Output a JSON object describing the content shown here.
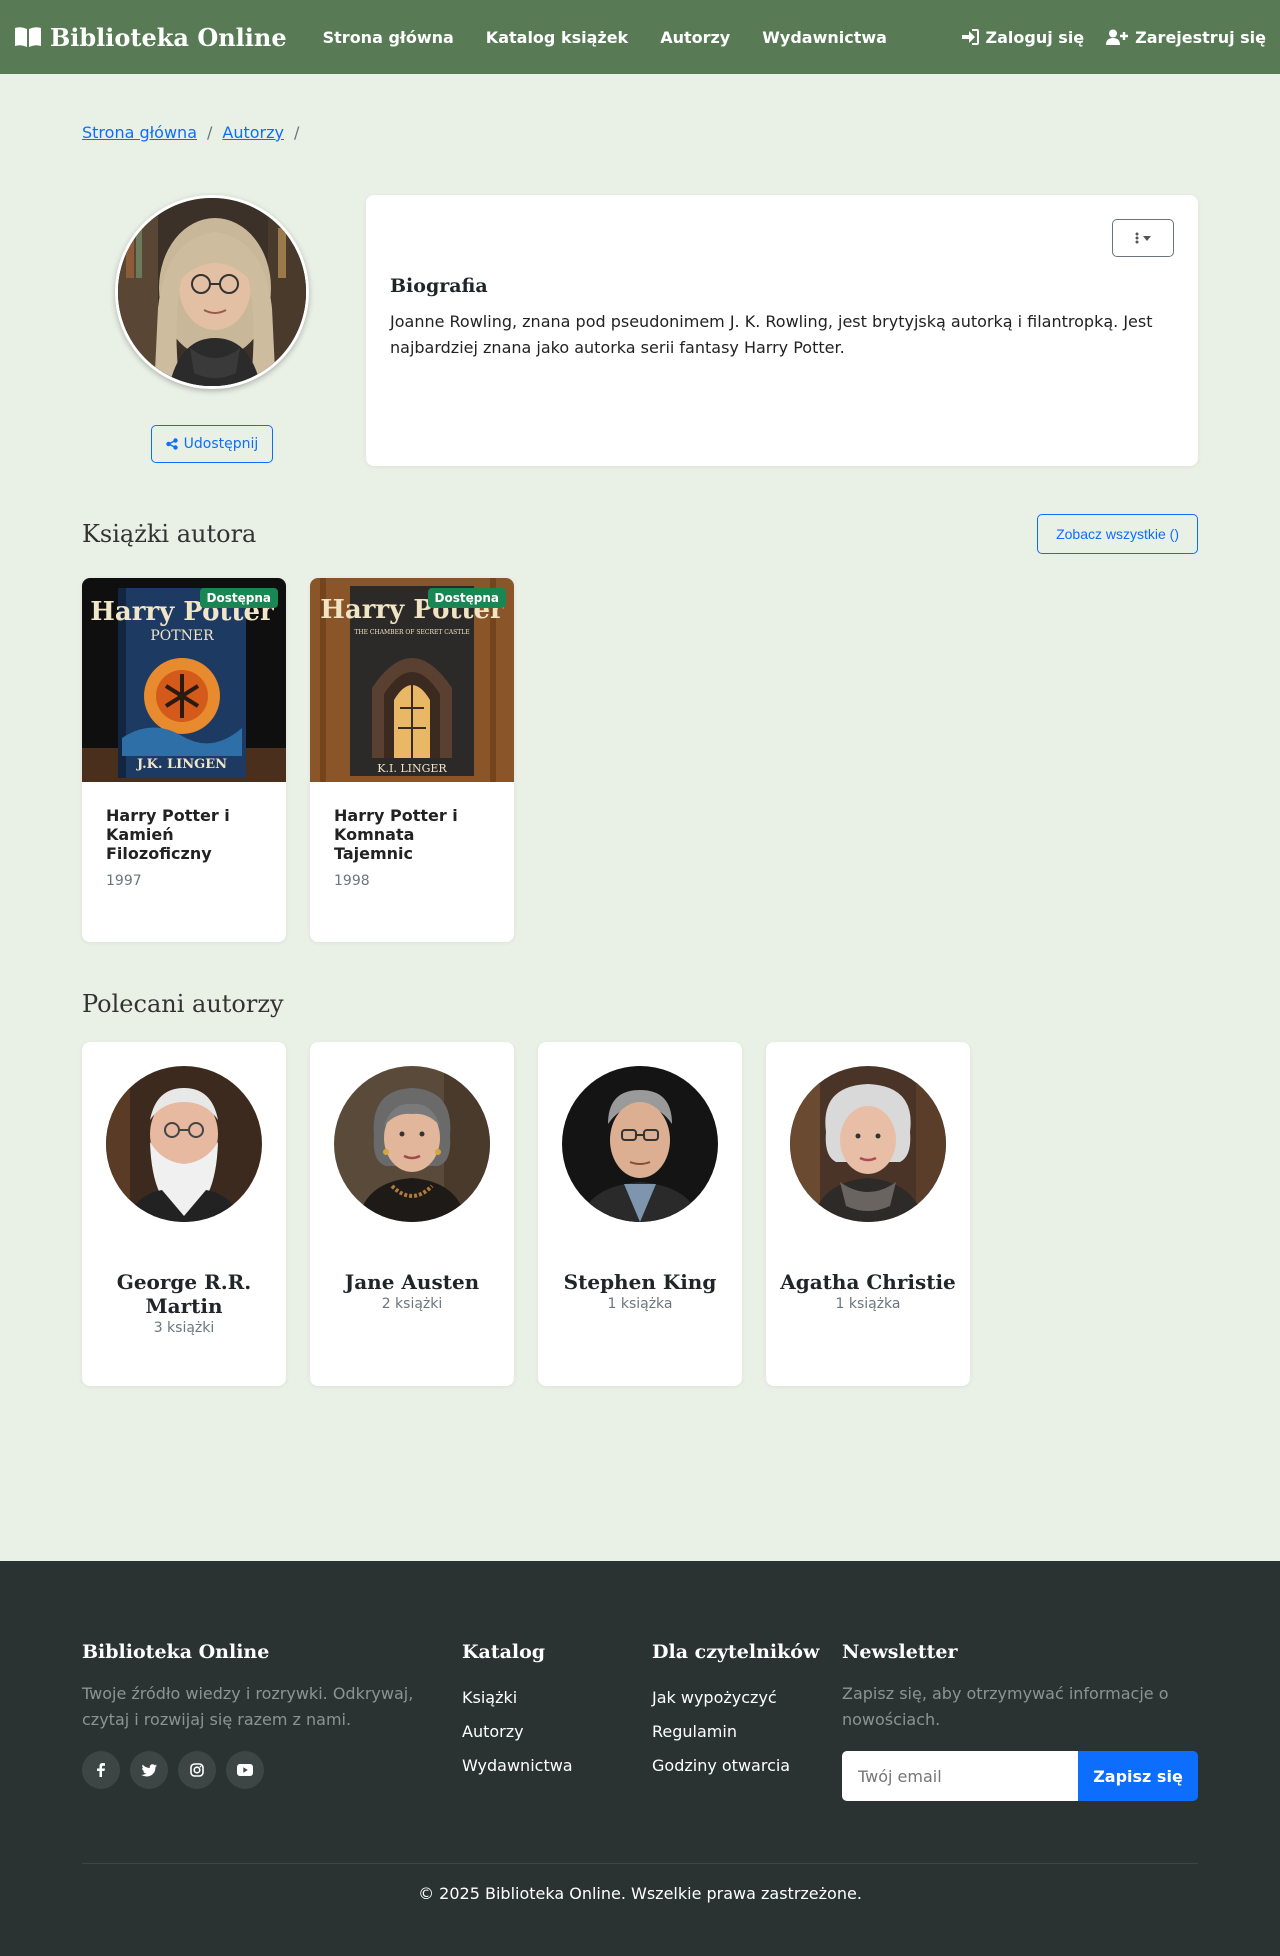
{
  "nav": {
    "brand": "Biblioteka Online",
    "links": [
      "Strona główna",
      "Katalog książek",
      "Autorzy",
      "Wydawnictwa"
    ],
    "login": "Zaloguj się",
    "register": "Zarejestruj się"
  },
  "breadcrumb": {
    "home": "Strona główna",
    "authors": "Autorzy"
  },
  "author": {
    "share_label": "Udostępnij",
    "bio_title": "Biografia",
    "bio_text": "Joanne Rowling, znana pod pseudonimem J. K. Rowling, jest brytyjską autorką i filantropką. Jest najbardziej znana jako autorka serii fantasy Harry Potter."
  },
  "books_section": {
    "title": "Książki autora",
    "see_all": "Zobacz wszystkie ()",
    "books": [
      {
        "title": "Harry Potter i Kamień Filozoficzny",
        "year": "1997",
        "badge": "Dostępna",
        "cover_title": "Harry Potter",
        "cover_sub": "POTNER",
        "cover_author": "J.K. LINGEN"
      },
      {
        "title": "Harry Potter i Komnata Tajemnic",
        "year": "1998",
        "badge": "Dostępna",
        "cover_title": "Harry Potter",
        "cover_sub": "THE CHAMBER OF SECRET CASTLE",
        "cover_author": "K.I. LINGER"
      }
    ]
  },
  "authors_section": {
    "title": "Polecani autorzy",
    "authors": [
      {
        "name": "George R.R. Martin",
        "count": "3 książki"
      },
      {
        "name": "Jane Austen",
        "count": "2 książki"
      },
      {
        "name": "Stephen King",
        "count": "1 książka"
      },
      {
        "name": "Agatha Christie",
        "count": "1 książka"
      }
    ]
  },
  "footer": {
    "brand": "Biblioteka Online",
    "tagline": "Twoje źródło wiedzy i rozrywki. Odkrywaj, czytaj i rozwijaj się razem z nami.",
    "catalog_title": "Katalog",
    "catalog_links": [
      "Książki",
      "Autorzy",
      "Wydawnictwa"
    ],
    "readers_title": "Dla czytelników",
    "readers_links": [
      "Jak wypożyczyć",
      "Regulamin",
      "Godziny otwarcia"
    ],
    "newsletter_title": "Newsletter",
    "newsletter_text": "Zapisz się, aby otrzymywać informacje o nowościach.",
    "email_placeholder": "Twój email",
    "subscribe": "Zapisz się",
    "copyright": "© 2025 Biblioteka Online. Wszelkie prawa zastrzeżone."
  },
  "colors": {
    "navbar": "#587b56",
    "page_bg": "#e9f0e6",
    "accent": "#0d6efd",
    "badge": "#198754",
    "footer": "#2a3332"
  }
}
